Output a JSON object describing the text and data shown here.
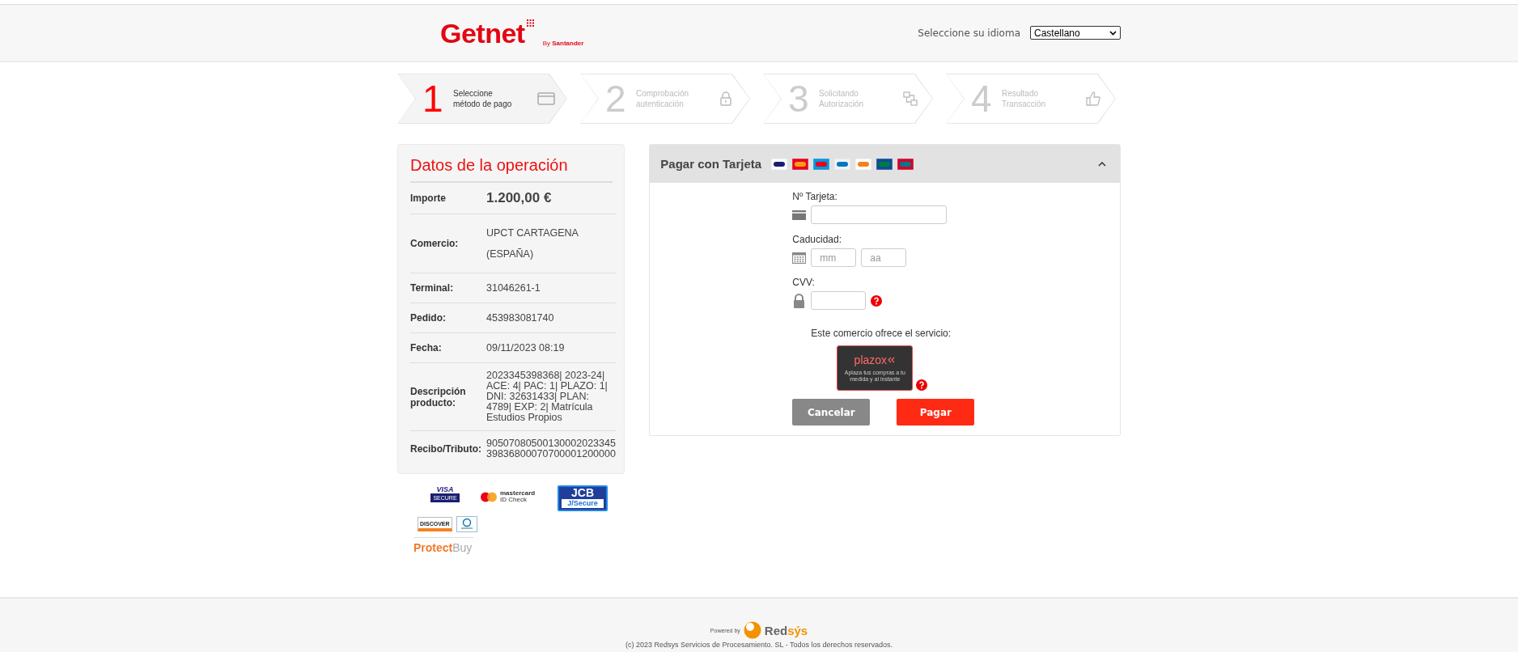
{
  "header": {
    "logo": "Getnet",
    "logo_sub": "By",
    "logo_brand": "Santander",
    "language_label": "Seleccione su idioma",
    "language": "Castellano"
  },
  "steps": [
    {
      "number": "1",
      "label": "Seleccione",
      "label2": "método de pago",
      "selected": true
    },
    {
      "number": "2",
      "label": "Comprobación",
      "label2": "autenticación",
      "selected": false
    },
    {
      "number": "3",
      "label": "Solicitando",
      "label2": "Autorización",
      "selected": false
    },
    {
      "number": "4",
      "label": "Resultado",
      "label2": "Transacción",
      "selected": false
    }
  ],
  "operation": {
    "title": "Datos de la operación",
    "rows": [
      {
        "kind": "amount",
        "label": "Importe",
        "value": "1.200,00 €"
      },
      {
        "kind": "spaced",
        "label": "Comercio:",
        "value": "UPCT CARTAGENA (ESPAÑA)"
      },
      {
        "kind": "text",
        "label": "Terminal:",
        "value": "31046261-1"
      },
      {
        "kind": "text",
        "label": "Pedido:",
        "value": "453983081740"
      },
      {
        "kind": "text",
        "label": "Fecha:",
        "value": "09/11/2023  08:19"
      },
      {
        "kind": "dense",
        "label": "Descripción producto:",
        "value": "2023345398368| 2023-24| ACE: 4| PAC: 1| PLAZO: 1| DNI: 32631433| PLAN: 4789| EXP: 2| Matrícula Estudios Propios"
      },
      {
        "kind": "dense",
        "label": "Recibo/Tributo:",
        "value": "9050708050013000202334539836800070700001200000"
      }
    ]
  },
  "secure_logos": {
    "visa": "VISA",
    "visa_sub": "SECURE",
    "mastercard": "mastercard",
    "mastercard_sub": "ID Check",
    "jcb": "JCB",
    "jcb_sub": "J/Secure",
    "discover": "DISCOVER",
    "protect": "Protect",
    "protect_accent": "Buy"
  },
  "card_form": {
    "title": "Pagar con Tarjeta",
    "expanded": true,
    "card_label": "Nº Tarjeta:",
    "expiry_label": "Caducidad:",
    "month_placeholder": "mm",
    "year_placeholder": "aa",
    "cvv_label": "CVV:",
    "service_text": "Este comercio ofrece el servicio:",
    "plazox": "plazox",
    "plazox_tagline": "Aplaza tus compras a tu medida y al instante",
    "buttons": [
      {
        "kind": "cancel",
        "label": "Cancelar"
      },
      {
        "kind": "pay",
        "label": "Pagar"
      }
    ]
  },
  "footer": {
    "powered_by": "Powered by",
    "logo": "Red",
    "logo_accent": "sýs",
    "copyright": "(c) 2023 Redsys Servicios de Procesamiento. SL - Todos los derechos reservados."
  }
}
